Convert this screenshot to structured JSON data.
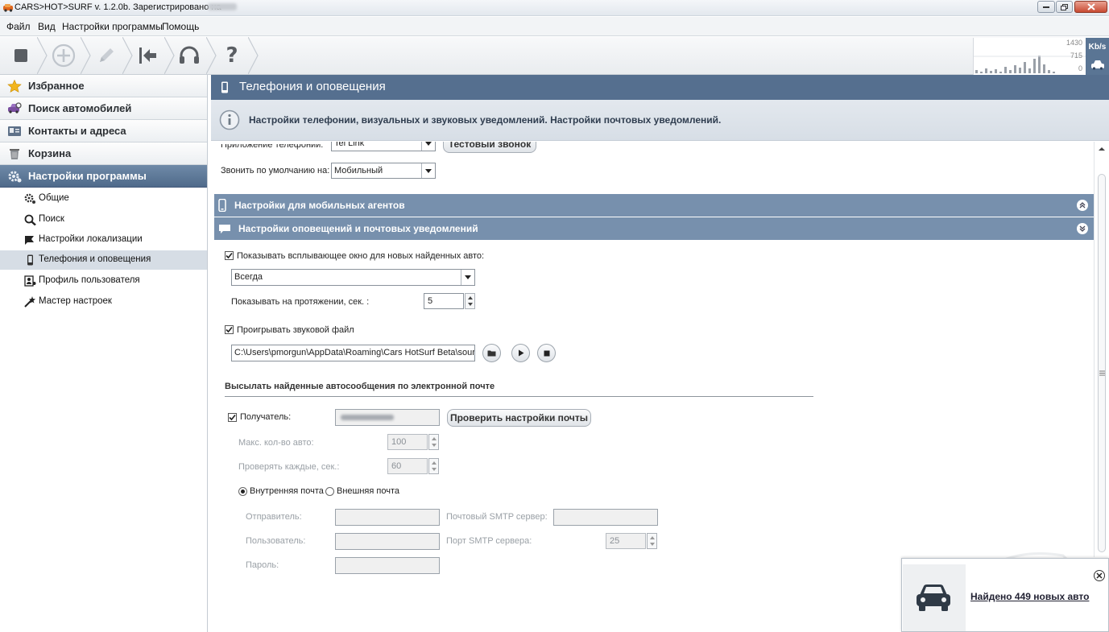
{
  "window": {
    "title": "CARS>HOT>SURF v. 1.2.0b. Зарегистрировано на"
  },
  "menu": [
    "Файл",
    "Вид",
    "Настройки программы",
    "Помощь"
  ],
  "toolbar": {
    "buttons": [
      "stop-icon",
      "add-icon",
      "edit-icon",
      "back-icon",
      "support-icon",
      "help-icon"
    ],
    "speed": {
      "max": "1430",
      "mid": "715",
      "min": "0",
      "unit": "Kb/s"
    }
  },
  "sidebar": {
    "categories": [
      {
        "label": "Избранное",
        "icon": "star-icon"
      },
      {
        "label": "Поиск автомобилей",
        "icon": "car-search-icon"
      },
      {
        "label": "Контакты и адреса",
        "icon": "contacts-icon"
      },
      {
        "label": "Корзина",
        "icon": "trash-icon"
      },
      {
        "label": "Настройки программы",
        "icon": "settings-icon",
        "active": true
      }
    ],
    "subitems": [
      {
        "label": "Общие",
        "icon": "gear-icon"
      },
      {
        "label": "Поиск",
        "icon": "magnifier-icon"
      },
      {
        "label": "Настройки локализации",
        "icon": "flag-icon"
      },
      {
        "label": "Телефония и оповещения",
        "icon": "phone-icon",
        "selected": true
      },
      {
        "label": "Профиль пользователя",
        "icon": "user-profile-icon"
      },
      {
        "label": "Мастер настроек",
        "icon": "wizard-icon"
      }
    ]
  },
  "content": {
    "title": "Телефония и оповещения",
    "info": "Настройки телефонии, визуальных и звуковых уведомлений. Настройки почтовых уведомлений.",
    "phone_app_label": "Приложение телефонии:",
    "phone_app_value": "Tel Link",
    "test_call": "Тестовый звонок",
    "default_call_label": "Звонить по умолчанию на:",
    "default_call_value": "Мобильный",
    "section_mobile": "Настройки для мобильных агентов",
    "section_notify": "Настройки оповещений и почтовых уведомлений",
    "show_popup_label": "Показывать всплывающее окно для новых найденных авто:",
    "show_popup_checked": true,
    "popup_mode": "Всегда",
    "show_duration_label": "Показывать на протяжении, сек. :",
    "show_duration_value": "5",
    "play_sound_label": "Проигрывать звуковой файл",
    "play_sound_checked": true,
    "sound_path": "C:\\Users\\pmorgun\\AppData\\Roaming\\Cars HotSurf Beta\\sounds\\",
    "email_section": "Высылать найденные автосообщения по электронной почте",
    "recipient_label": "Получатель:",
    "recipient_checked": true,
    "check_mail": "Проверить настройки почты",
    "max_cars_label": "Макс. кол-во авто:",
    "max_cars_value": "100",
    "check_every_label": "Проверять каждые, сек.:",
    "check_every_value": "60",
    "internal_mail": "Внутренняя почта",
    "external_mail": "Внешняя почта",
    "mail_mode": "internal",
    "sender_label": "Отправитель:",
    "user_label": "Пользователь:",
    "password_label": "Пароль:",
    "smtp_server_label": "Почтовый SMTP сервер:",
    "smtp_port_label": "Порт SMTP сервера:",
    "smtp_port_value": "25"
  },
  "popup": {
    "text": "Найдено 449 новых авто"
  }
}
